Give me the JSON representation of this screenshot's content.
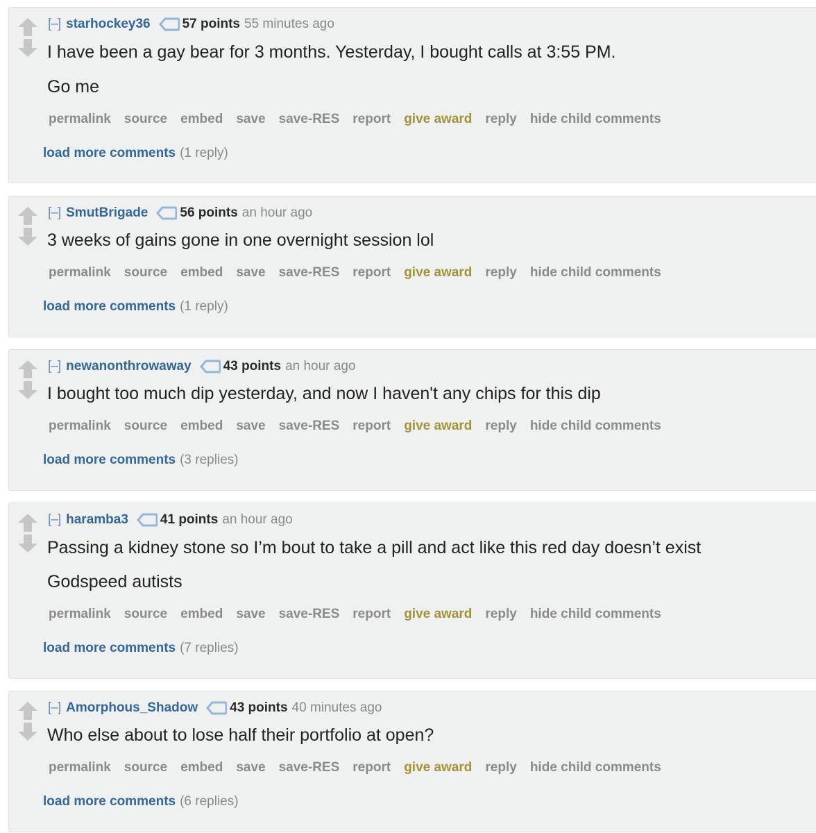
{
  "theme": {
    "author_color": "#336699",
    "award_color": "#a39137",
    "button_color": "#8a8a8a",
    "background": "#eff1f1"
  },
  "icons": {
    "upvote": "upvote-arrow-icon",
    "downvote": "downvote-arrow-icon",
    "flair": "tag-icon"
  },
  "collapse_label": "[–]",
  "buttons": {
    "permalink": "permalink",
    "source": "source",
    "embed": "embed",
    "save": "save",
    "save_res": "save-RES",
    "report": "report",
    "give_award": "give award",
    "reply": "reply",
    "hide_child": "hide child comments"
  },
  "load_more_label": "load more comments",
  "comments": [
    {
      "author": "starhockey36",
      "score": "57 points",
      "time": "55 minutes ago",
      "lines": [
        "I have been a gay bear for 3 months. Yesterday, I bought calls at 3:55 PM.",
        "Go me"
      ],
      "replies": "(1 reply)"
    },
    {
      "author": "SmutBrigade",
      "score": "56 points",
      "time": "an hour ago",
      "lines": [
        "3 weeks of gains gone in one overnight session lol"
      ],
      "replies": "(1 reply)"
    },
    {
      "author": "newanonthrowaway",
      "score": "43 points",
      "time": "an hour ago",
      "lines": [
        "I bought too much dip yesterday, and now I haven't any chips for this dip"
      ],
      "replies": "(3 replies)"
    },
    {
      "author": "haramba3",
      "score": "41 points",
      "time": "an hour ago",
      "lines": [
        "Passing a kidney stone so I’m bout to take a pill and act like this red day doesn’t exist",
        "Godspeed autists"
      ],
      "replies": "(7 replies)"
    },
    {
      "author": "Amorphous_Shadow",
      "score": "43 points",
      "time": "40 minutes ago",
      "lines": [
        "Who else about to lose half their portfolio at open?"
      ],
      "replies": "(6 replies)"
    }
  ]
}
